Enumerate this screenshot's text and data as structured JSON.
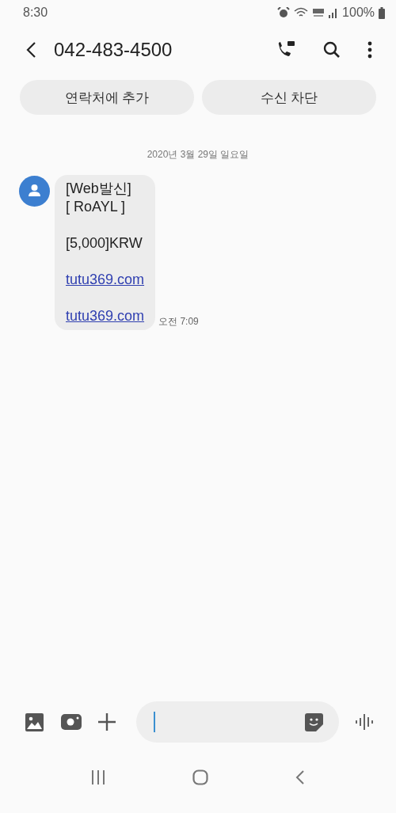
{
  "status_bar": {
    "time": "8:30",
    "battery": "100%"
  },
  "header": {
    "title": "042-483-4500"
  },
  "actions": [
    "연락처에 추가",
    "수신 차단"
  ],
  "date_divider": "2020년 3월 29일 일요일",
  "message": {
    "blocks": [
      {
        "kind": "text",
        "lines": [
          "[Web발신]",
          "[ RoAYL ]"
        ]
      },
      {
        "kind": "text",
        "lines": [
          "[5,000]KRW"
        ]
      },
      {
        "kind": "link",
        "lines": [
          "tutu369.com"
        ]
      },
      {
        "kind": "link",
        "lines": [
          "tutu369.com"
        ]
      }
    ],
    "time": "오전 7:09"
  }
}
